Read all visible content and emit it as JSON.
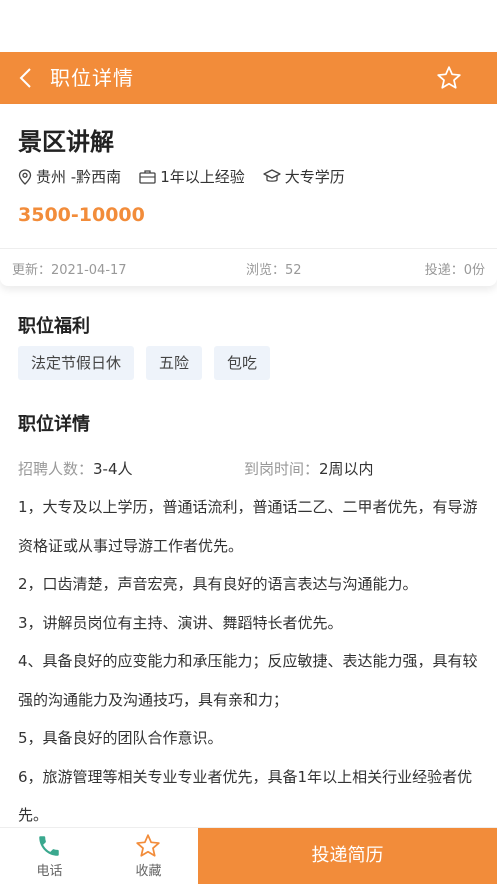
{
  "header": {
    "title": "职位详情"
  },
  "job": {
    "title": "景区讲解",
    "location": "贵州 -黔西南",
    "experience": "1年以上经验",
    "education": "大专学历",
    "salary": "3500-10000",
    "update": "更新：2021-04-17",
    "views": "浏览：52",
    "applied": "投递：0份"
  },
  "benefits": {
    "title": "职位福利",
    "tags": [
      "法定节假日休",
      "五险",
      "包吃"
    ]
  },
  "details": {
    "title": "职位详情",
    "headcount_label": "招聘人数：",
    "headcount_value": "3-4人",
    "onboard_label": "到岗时间：",
    "onboard_value": "2周以内",
    "lines": [
      "1，大专及以上学历，普通话流利，普通话二乙、二甲者优先，有导游资格证或从事过导游工作者优先。",
      "2，口齿清楚，声音宏亮，具有良好的语言表达与沟通能力。",
      "3，讲解员岗位有主持、演讲、舞蹈特长者优先。",
      "4、具备良好的应变能力和承压能力；反应敏捷、表达能力强，具有较强的沟通能力及沟通技巧，具有亲和力；",
      "5，具备良好的团队合作意识。",
      "6，旅游管理等相关专业专业者优先，具备1年以上相关行业经验者优先。"
    ]
  },
  "bottom": {
    "phone_label": "电话",
    "fav_label": "收藏",
    "apply_label": "投递简历"
  },
  "colors": {
    "accent": "#f28c3a",
    "phone_icon": "#3aa88e"
  },
  "icons": [
    "back-arrow-icon",
    "star-icon",
    "location-pin-icon",
    "briefcase-icon",
    "graduation-cap-icon",
    "phone-icon"
  ]
}
